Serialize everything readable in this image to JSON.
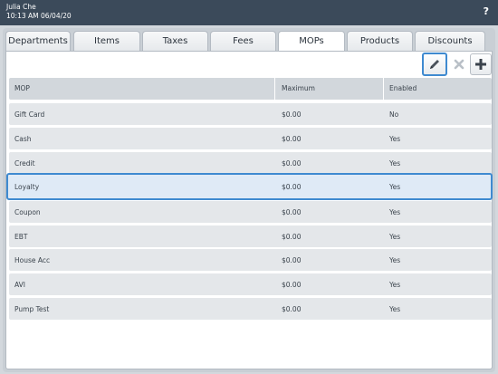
{
  "header": {
    "user_name": "Julia Che",
    "datetime": "10:13 AM 06/04/20",
    "help_label": "?"
  },
  "tabs": [
    {
      "label": "Departments",
      "active": false
    },
    {
      "label": "Items",
      "active": false
    },
    {
      "label": "Taxes",
      "active": false
    },
    {
      "label": "Fees",
      "active": false
    },
    {
      "label": "MOPs",
      "active": true
    },
    {
      "label": "Products",
      "active": false
    },
    {
      "label": "Discounts",
      "active": false
    }
  ],
  "toolbar": {
    "edit_icon": "pencil-icon",
    "delete_icon": "close-icon",
    "add_icon": "plus-icon"
  },
  "table": {
    "columns": [
      "MOP",
      "Maximum",
      "Enabled"
    ],
    "rows": [
      {
        "mop": "Gift Card",
        "maximum": "$0.00",
        "enabled": "No"
      },
      {
        "mop": "Cash",
        "maximum": "$0.00",
        "enabled": "Yes"
      },
      {
        "mop": "Credit",
        "maximum": "$0.00",
        "enabled": "Yes"
      },
      {
        "mop": "Loyalty",
        "maximum": "$0.00",
        "enabled": "Yes"
      },
      {
        "mop": "Coupon",
        "maximum": "$0.00",
        "enabled": "Yes"
      },
      {
        "mop": "EBT",
        "maximum": "$0.00",
        "enabled": "Yes"
      },
      {
        "mop": "House Acc",
        "maximum": "$0.00",
        "enabled": "Yes"
      },
      {
        "mop": "AVI",
        "maximum": "$0.00",
        "enabled": "Yes"
      },
      {
        "mop": "Pump Test",
        "maximum": "$0.00",
        "enabled": "Yes"
      }
    ],
    "selected_row": "Loyalty"
  },
  "colors": {
    "topbar": "#3b4a5a",
    "selection_accent": "#3f8ad0"
  }
}
